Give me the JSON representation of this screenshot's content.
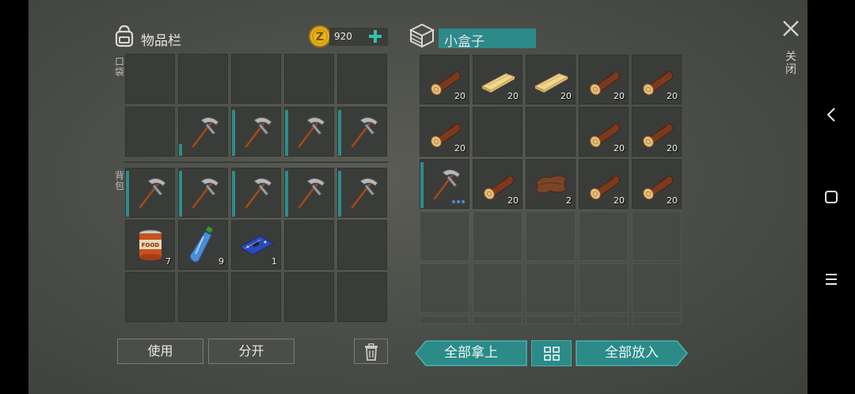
{
  "inventory": {
    "title": "物品栏",
    "coins": "920",
    "pocket_label": "口袋",
    "backpack_label": "背包",
    "use_label": "使用",
    "split_label": "分开",
    "pocket": [
      {
        "item": "",
        "count": ""
      },
      {
        "item": "",
        "count": ""
      },
      {
        "item": "",
        "count": ""
      },
      {
        "item": "",
        "count": ""
      },
      {
        "item": "",
        "count": ""
      },
      {
        "item": "",
        "count": ""
      },
      {
        "item": "pickaxe",
        "count": "",
        "dur": 0.25
      },
      {
        "item": "pickaxe",
        "count": "",
        "dur": 0.95
      },
      {
        "item": "pickaxe",
        "count": "",
        "dur": 0.95
      },
      {
        "item": "pickaxe",
        "count": "",
        "dur": 0.95
      }
    ],
    "backpack": [
      {
        "item": "pickaxe",
        "count": "",
        "dur": 0.95
      },
      {
        "item": "pickaxe",
        "count": "",
        "dur": 0.95
      },
      {
        "item": "pickaxe",
        "count": "",
        "dur": 0.95
      },
      {
        "item": "pickaxe",
        "count": "",
        "dur": 0.95
      },
      {
        "item": "pickaxe",
        "count": "",
        "dur": 0.95
      },
      {
        "item": "canned-food",
        "count": "7"
      },
      {
        "item": "water-bottle",
        "count": "9"
      },
      {
        "item": "circuit-board",
        "count": "1"
      },
      {
        "item": "",
        "count": ""
      },
      {
        "item": "",
        "count": ""
      },
      {
        "item": "",
        "count": ""
      },
      {
        "item": "",
        "count": ""
      },
      {
        "item": "",
        "count": ""
      },
      {
        "item": "",
        "count": ""
      },
      {
        "item": "",
        "count": ""
      }
    ]
  },
  "container": {
    "title": "小盒子",
    "take_all_label": "全部拿上",
    "put_all_label": "全部放入",
    "slots": [
      {
        "item": "log",
        "count": "20"
      },
      {
        "item": "plank",
        "count": "20"
      },
      {
        "item": "plank",
        "count": "20"
      },
      {
        "item": "log",
        "count": "20"
      },
      {
        "item": "log",
        "count": "20"
      },
      {
        "item": "log",
        "count": "20"
      },
      {
        "item": "",
        "count": ""
      },
      {
        "item": "",
        "count": ""
      },
      {
        "item": "log",
        "count": "20"
      },
      {
        "item": "log",
        "count": "20"
      },
      {
        "item": "pickaxe",
        "count": "",
        "dur": 0.95
      },
      {
        "item": "log",
        "count": "20"
      },
      {
        "item": "leather",
        "count": "2"
      },
      {
        "item": "log",
        "count": "20"
      },
      {
        "item": "log",
        "count": "20"
      }
    ],
    "empty_rows": 3
  },
  "close_label": "关闭",
  "colors": {
    "teal": "#2c8a88",
    "accent_plus": "#35c2a8",
    "coin": "#e8b21c"
  },
  "icons": [
    "backpack-icon",
    "coin-icon",
    "plus-icon",
    "box-icon",
    "close-icon",
    "trash-icon",
    "sort-icon",
    "back-icon",
    "home-icon",
    "menu-icon"
  ]
}
